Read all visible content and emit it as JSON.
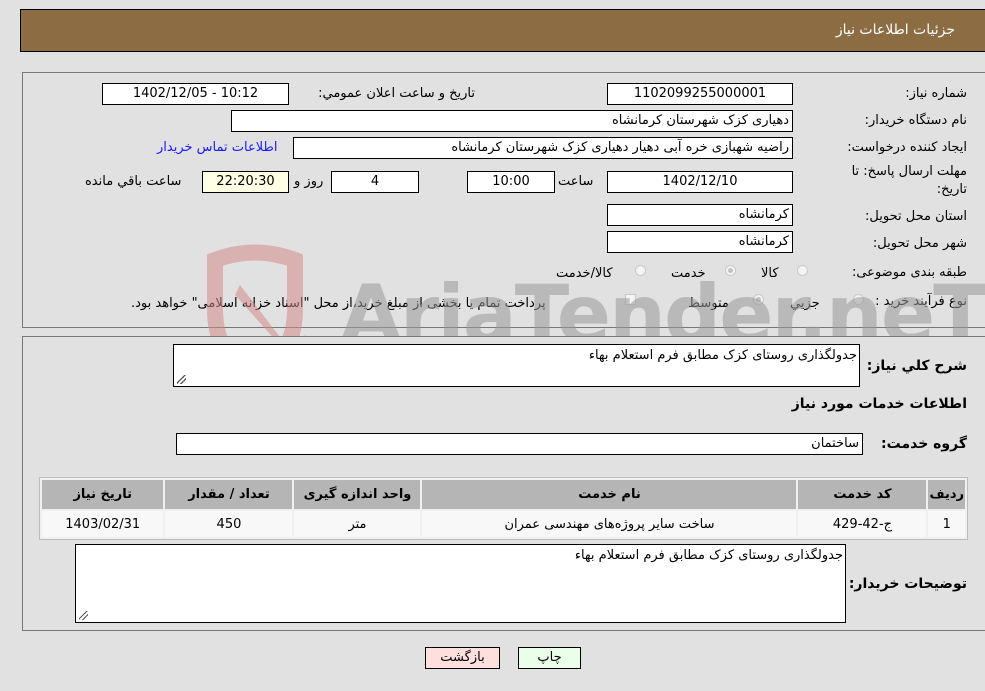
{
  "header": {
    "title": "جزئیات اطلاعات نیاز"
  },
  "details": {
    "need_number": {
      "label": "شماره نیاز:",
      "value": "1102099255000001"
    },
    "announce_datetime": {
      "label": "تاریخ و ساعت اعلان عمومي:",
      "value": "1402/12/05 - 10:12"
    },
    "buyer_org": {
      "label": "نام دستگاه خریدار:",
      "value": "دهیاری کزک شهرستان کرمانشاه"
    },
    "requester": {
      "label": "ایجاد کننده درخواست:",
      "value": "راضیه شهبازی خره آبی دهیار دهیاری کزک شهرستان کرمانشاه"
    },
    "contact_link": "اطلاعات تماس خریدار",
    "deadline": {
      "label_line1": "مهلت ارسال پاسخ: تا",
      "label_line2": "تاریخ:",
      "date": "1402/12/10",
      "time_label": "ساعت",
      "time": "10:00",
      "days": "4",
      "days_label": "روز و",
      "remaining": "22:20:30",
      "remaining_label": "ساعت باقي مانده"
    },
    "province": {
      "label": "استان محل تحویل:",
      "value": "کرمانشاه"
    },
    "city": {
      "label": "شهر محل تحویل:",
      "value": "کرمانشاه"
    },
    "category": {
      "label": "طبقه بندی موضوعی:",
      "options": [
        "کالا",
        "خدمت",
        "کالا/خدمت"
      ],
      "selected": "خدمت"
    },
    "purchase_type": {
      "label": "نوع فرآیند خرید :",
      "options": [
        "جزیي",
        "متوسط"
      ],
      "selected": "متوسط",
      "treasury_note": "پرداخت تمام یا بخشی از مبلغ خرید،از محل \"اسناد خزانه اسلامی\" خواهد بود."
    }
  },
  "description": {
    "label": "شرح کلي نیاز:",
    "value": "جدولگذاری روستای کزک مطابق فرم استعلام بهاء"
  },
  "services": {
    "section_title": "اطلاعات خدمات مورد نیاز",
    "group_label": "گروه خدمت:",
    "group_value": "ساختمان",
    "table": {
      "columns": [
        "ردیف",
        "کد خدمت",
        "نام خدمت",
        "واحد اندازه گیری",
        "تعداد / مقدار",
        "تاریخ نیاز"
      ],
      "rows": [
        [
          "1",
          "ج-42-429",
          "ساخت سایر پروژه‌های مهندسی عمران",
          "متر",
          "450",
          "1403/02/31"
        ]
      ]
    }
  },
  "buyer_notes": {
    "label": "توضیحات خریدار:",
    "value": "جدولگذاری روستای کزک مطابق فرم استعلام بهاء"
  },
  "buttons": {
    "print": "چاپ",
    "back": "بازگشت"
  },
  "watermark": {
    "text": "AriaTender.neT"
  }
}
